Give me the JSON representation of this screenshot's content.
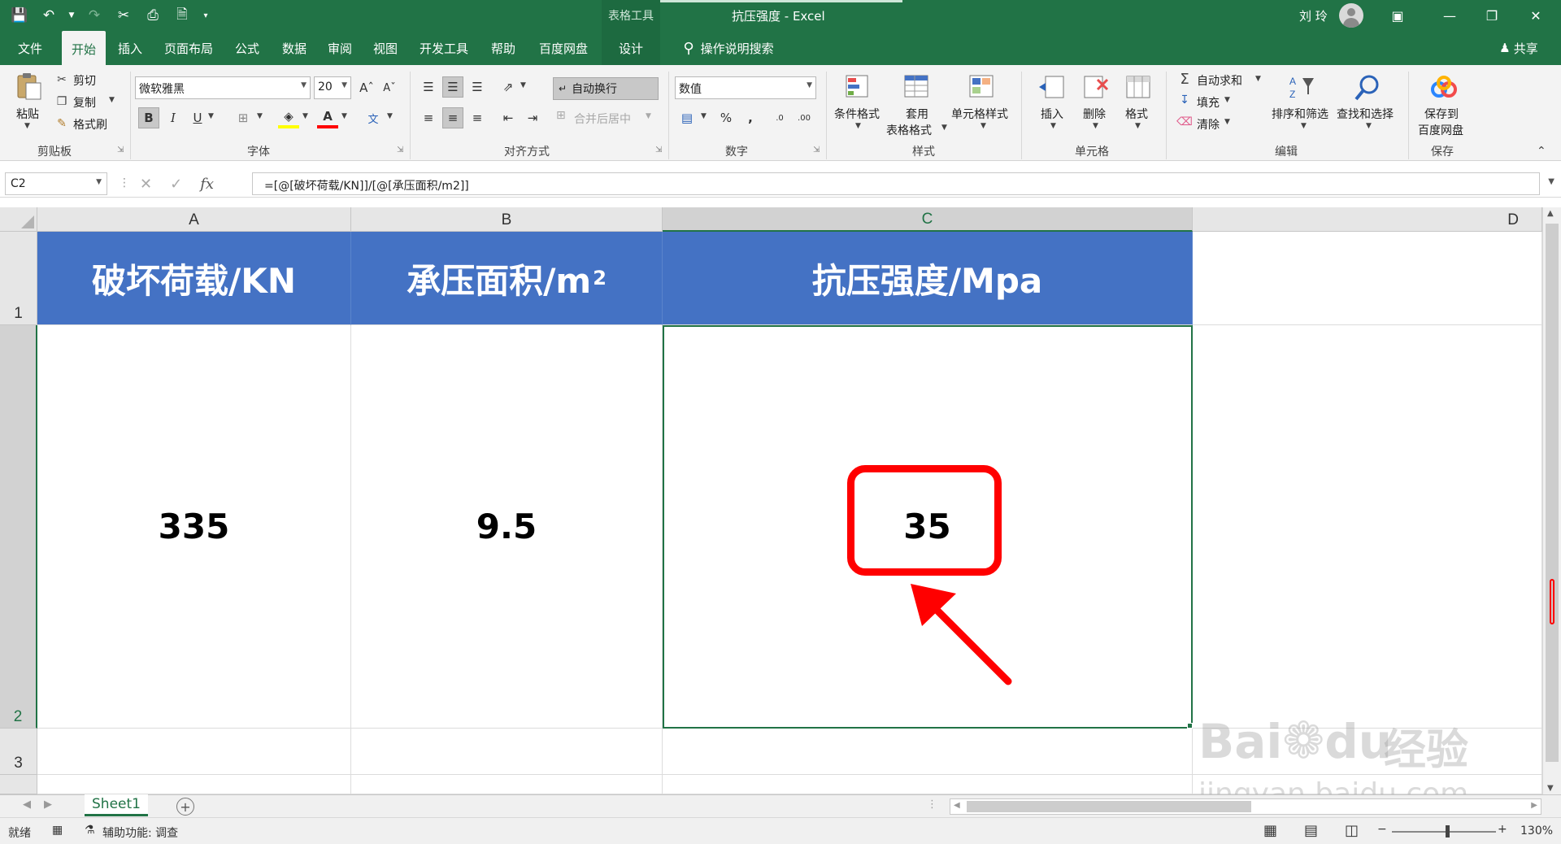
{
  "title_bar": {
    "context_tools": "表格工具",
    "window_title": "抗压强度  -  Excel",
    "user_name": "刘 玲"
  },
  "ribbon_tabs": [
    "文件",
    "开始",
    "插入",
    "页面布局",
    "公式",
    "数据",
    "审阅",
    "视图",
    "开发工具",
    "帮助",
    "百度网盘",
    "设计"
  ],
  "active_tab": "开始",
  "tell_me": "操作说明搜索",
  "share": "共享",
  "clipboard": {
    "paste": "粘贴",
    "cut": "剪切",
    "copy": "复制",
    "format_painter": "格式刷",
    "label": "剪贴板"
  },
  "font": {
    "name": "微软雅黑",
    "size": "20",
    "label": "字体"
  },
  "alignment": {
    "wrap_text": "自动换行",
    "merge_center": "合并后居中",
    "label": "对齐方式"
  },
  "number": {
    "format": "数值",
    "label": "数字"
  },
  "styles": {
    "conditional": "条件格式",
    "table_format_1": "套用",
    "table_format_2": "表格格式",
    "cell_styles": "单元格样式",
    "label": "样式"
  },
  "cells": {
    "insert": "插入",
    "delete": "删除",
    "format": "格式",
    "label": "单元格"
  },
  "editing": {
    "autosum": "自动求和",
    "fill": "填充",
    "clear": "清除",
    "sort_filter": "排序和筛选",
    "find_select": "查找和选择",
    "label": "编辑"
  },
  "save_group": {
    "save_1": "保存到",
    "save_2": "百度网盘",
    "label": "保存"
  },
  "formula_bar": {
    "name_box": "C2",
    "formula": "=[@[破坏荷载/KN]]/[@[承压面积/m2]]"
  },
  "columns": [
    "A",
    "B",
    "C",
    "D"
  ],
  "rows": [
    "1",
    "2",
    "3"
  ],
  "table": {
    "headers": {
      "a": "破坏荷载/KN",
      "b": "承压面积/m",
      "b_sup": "2",
      "c": "抗压强度/Mpa"
    },
    "row2": {
      "a": "335",
      "b": "9.5",
      "c": "35"
    }
  },
  "sheet_tab": "Sheet1",
  "status": {
    "ready": "就绪",
    "accessibility": "辅助功能: 调查",
    "zoom": "130%"
  },
  "watermark": {
    "brand": "Bai",
    "brand_suffix": "du",
    "brand_cn": "经验",
    "url": "jingyan.baidu.com"
  },
  "colors": {
    "excel_green": "#217346",
    "header_blue": "#4472c4",
    "annotation_red": "#ff0000"
  }
}
